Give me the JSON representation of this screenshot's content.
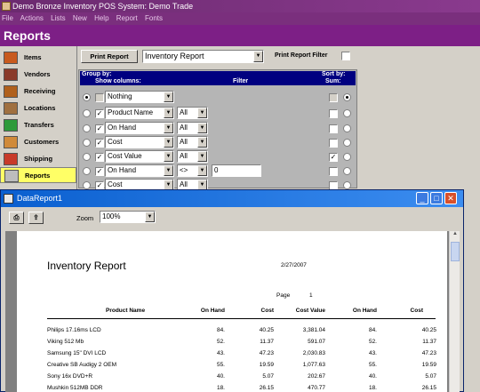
{
  "window": {
    "title": "Demo Bronze Inventory POS System: Demo Trade"
  },
  "menu": [
    "File",
    "Actions",
    "Lists",
    "New",
    "Help",
    "Report",
    "Fonts"
  ],
  "header": {
    "title": "Reports"
  },
  "nav": {
    "items": [
      {
        "label": "Items",
        "icon": "items-icon",
        "color": "#c85a1e"
      },
      {
        "label": "Vendors",
        "icon": "vendors-icon",
        "color": "#8a3a2a"
      },
      {
        "label": "Receiving",
        "icon": "receiving-truck-icon",
        "color": "#b0601c"
      },
      {
        "label": "Locations",
        "icon": "locations-house-icon",
        "color": "#a07040"
      },
      {
        "label": "Transfers",
        "icon": "transfers-recycle-icon",
        "color": "#2e9a3a"
      },
      {
        "label": "Customers",
        "icon": "customers-icon",
        "color": "#d08a3a"
      },
      {
        "label": "Shipping",
        "icon": "shipping-truck-icon",
        "color": "#c83a2a"
      },
      {
        "label": "Reports",
        "icon": "reports-icon",
        "color": "#7a7a7a",
        "active": true
      }
    ]
  },
  "toolbar": {
    "print_button": "Print Report",
    "report_select": "Inventory Report",
    "print_filter_label": "Print Report Filter"
  },
  "groupby": {
    "group_by_label": "Group by:",
    "sort_by_label": "Sort by:",
    "show_columns_label": "Show columns:",
    "filter_label": "Filter",
    "sum_label": "Sum:",
    "rows": [
      {
        "checked": false,
        "column": "Nothing",
        "op": "",
        "value": "",
        "sum": false
      },
      {
        "checked": true,
        "column": "Product Name",
        "op": "All",
        "value": "",
        "sum": false
      },
      {
        "checked": true,
        "column": "On Hand",
        "op": "All",
        "value": "",
        "sum": false
      },
      {
        "checked": true,
        "column": "Cost",
        "op": "All",
        "value": "",
        "sum": false
      },
      {
        "checked": true,
        "column": "Cost Value",
        "op": "All",
        "value": "",
        "sum": true
      },
      {
        "checked": true,
        "column": "On Hand",
        "op": "<>",
        "value": "0",
        "sum": false
      },
      {
        "checked": true,
        "column": "Cost",
        "op": "All",
        "value": "",
        "sum": false
      }
    ]
  },
  "report_window": {
    "title": "DataReport1",
    "zoom_label": "Zoom",
    "zoom_value": "100%"
  },
  "report": {
    "title": "Inventory Report",
    "date": "2/27/2007",
    "page_label": "Page",
    "page_number": "1",
    "columns": [
      "Product Name",
      "On Hand",
      "Cost",
      "Cost Value",
      "On Hand",
      "Cost"
    ],
    "rows": [
      [
        "Philips 17.16ms LCD",
        "84.",
        "40.25",
        "3,381.04",
        "84.",
        "40.25"
      ],
      [
        "Viking 512 Mb",
        "52.",
        "11.37",
        "591.07",
        "52.",
        "11.37"
      ],
      [
        "Samsung 15\" DVI LCD",
        "43.",
        "47.23",
        "2,030.83",
        "43.",
        "47.23"
      ],
      [
        "Creative SB Audigy 2 OEM",
        "55.",
        "19.59",
        "1,077.63",
        "55.",
        "19.59"
      ],
      [
        "Sony 16x DVD+R",
        "40.",
        "5.07",
        "202.67",
        "40.",
        "5.07"
      ],
      [
        "Mushkin 512MB DDR",
        "18.",
        "26.15",
        "470.77",
        "18.",
        "26.15"
      ]
    ]
  }
}
